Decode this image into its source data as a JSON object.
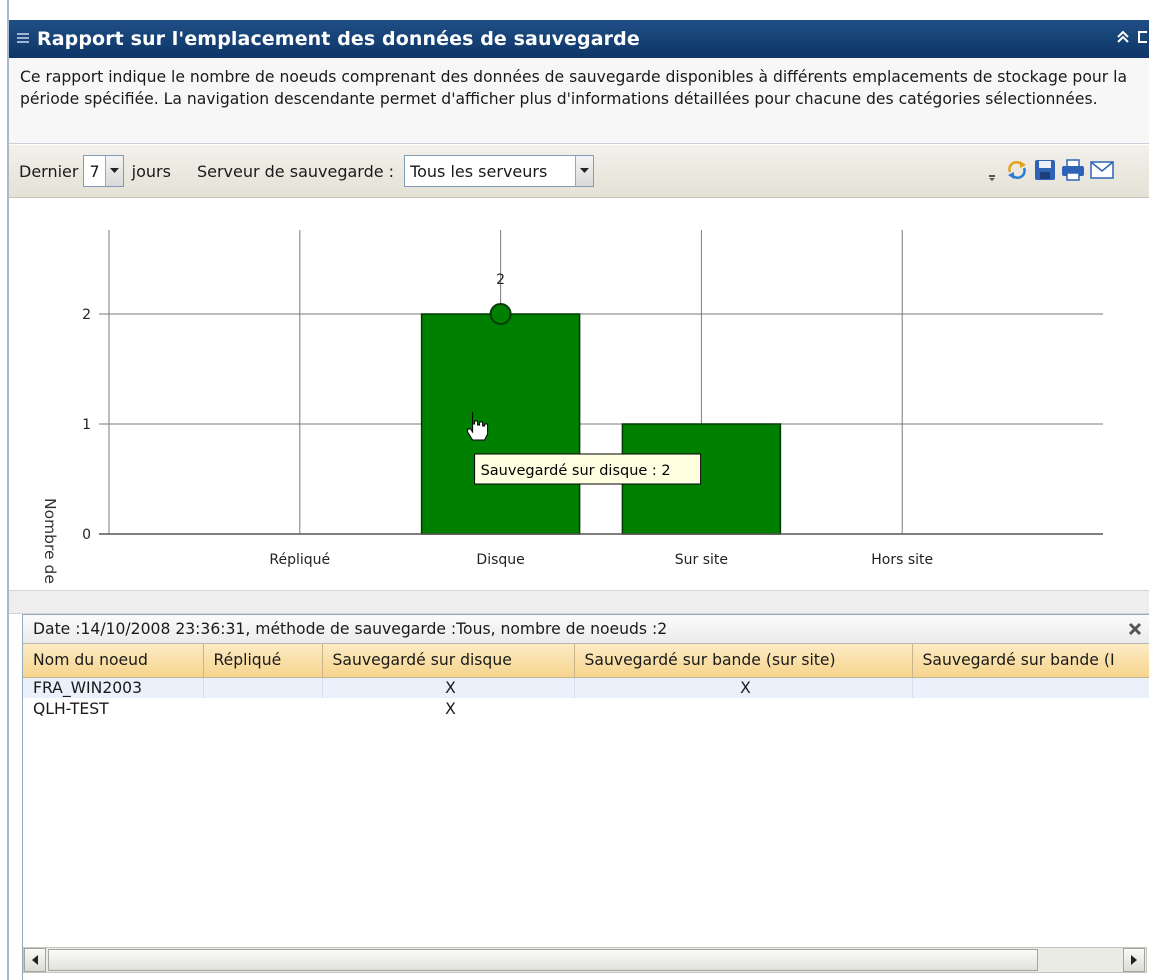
{
  "panel": {
    "title": "Rapport sur l'emplacement des données de sauvegarde",
    "description": "Ce rapport indique le nombre de noeuds comprenant des données de sauvegarde disponibles à différents emplacements de stockage pour la période spécifiée. La navigation descendante permet d'afficher plus d'informations détaillées pour chacune des catégories sélectionnées."
  },
  "toolbar": {
    "last_label": "Dernier",
    "days_value": "7",
    "days_label": "jours",
    "server_label": "Serveur de sauvegarde :",
    "server_value": "Tous les serveurs",
    "tools": [
      "refresh-icon",
      "save-icon",
      "print-icon",
      "email-icon"
    ]
  },
  "chart_data": {
    "type": "bar",
    "categories": [
      "Répliqué",
      "Disque",
      "Sur site",
      "Hors site"
    ],
    "values": [
      0,
      2,
      1,
      0
    ],
    "ylabel": "Nombre de noeuds",
    "xlabel": "",
    "ylim": [
      0,
      2
    ],
    "yticks": [
      0,
      1,
      2
    ],
    "data_labels": [
      "",
      "2",
      "",
      ""
    ],
    "bar_color": "#008000",
    "grid": true,
    "tooltip": "Sauvegardé sur disque : 2"
  },
  "details": {
    "header": "Date :14/10/2008 23:36:31, méthode de sauvegarde :Tous, nombre de noeuds :2",
    "columns": [
      "Nom du noeud",
      "Répliqué",
      "Sauvegardé sur disque",
      "Sauvegardé sur bande (sur site)",
      "Sauvegardé sur bande (I"
    ],
    "rows": [
      [
        "FRA_WIN2003",
        "",
        "X",
        "X",
        ""
      ],
      [
        "QLH-TEST",
        "",
        "X",
        "",
        ""
      ]
    ]
  },
  "colors": {
    "titlebar": "#1f4f86",
    "bar": "#008000",
    "header_gold": "#f6d58d",
    "selected_row": "#eaf1fb"
  }
}
